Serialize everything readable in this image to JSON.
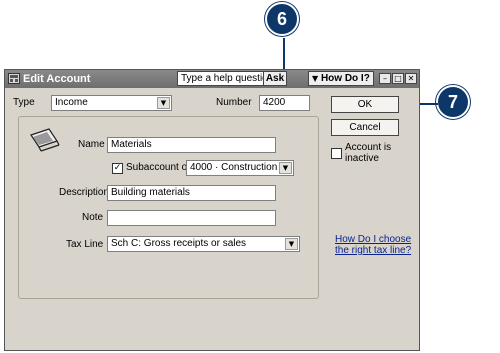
{
  "window": {
    "title": "Edit Account",
    "help_placeholder": "Type a help question",
    "ask_label": "Ask",
    "howdoi_label": "How Do I?"
  },
  "form": {
    "type_label": "Type",
    "type_value": "Income",
    "number_label": "Number",
    "number_value": "4200",
    "name_label": "Name",
    "name_value": "Materials",
    "subaccount_label": "Subaccount of",
    "subaccount_checked": true,
    "subaccount_value": "4000 · Construction",
    "description_label": "Description",
    "description_value": "Building materials",
    "note_label": "Note",
    "note_value": "",
    "taxline_label": "Tax Line",
    "taxline_value": "Sch C: Gross receipts or sales"
  },
  "side": {
    "ok_label": "OK",
    "cancel_label": "Cancel",
    "inactive_label_line1": "Account is",
    "inactive_label_line2": "inactive",
    "inactive_checked": false,
    "help_link_line1": "How Do I choose",
    "help_link_line2": "the right tax line?"
  },
  "callouts": {
    "first": "6",
    "second": "7"
  }
}
